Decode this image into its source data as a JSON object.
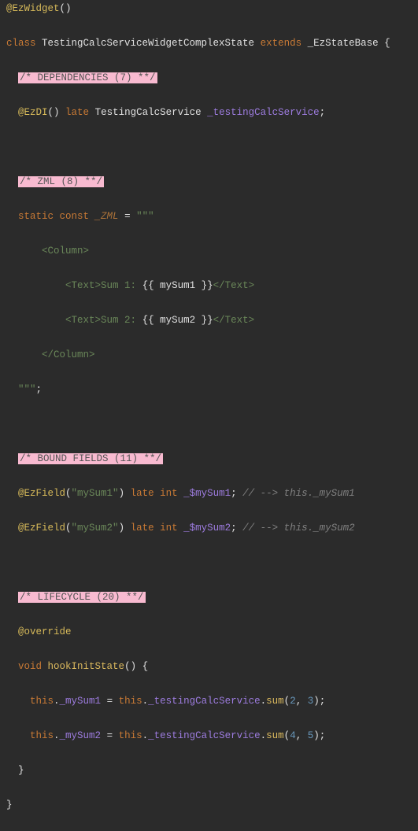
{
  "lines": {
    "l1_ann": "@EzWidget",
    "l1_par": "()",
    "l2_kw1": "class ",
    "l2_cls": "TestingCalcServiceWidgetComplexState",
    "l2_kw2": " extends ",
    "l2_base": "_EzStateBase",
    "l2_end": " {",
    "l3_hl": "/* DEPENDENCIES (7) **/",
    "l4_ann": "@EzDI",
    "l4_par": "()",
    "l4_late": " late ",
    "l4_typ": "TestingCalcService",
    "l4_id": " _testingCalcService",
    "l4_sc": ";",
    "l7_hl": "/* ZML (8) **/",
    "l8_kw": "static const ",
    "l8_id": "_ZML",
    "l8_eq": " = ",
    "l8_q": "\"\"\"",
    "l9": "    <Column>",
    "l10a": "        <Text>",
    "l10b": "Sum 1: ",
    "l10c": "{{ mySum1 }}",
    "l10d": "</Text>",
    "l11a": "        <Text>",
    "l11b": "Sum 2: ",
    "l11c": "{{ mySum2 }}",
    "l11d": "</Text>",
    "l12": "    </Column>",
    "l13_q": "\"\"\"",
    "l13_sc": ";",
    "l16_hl": "/* BOUND FIELDS (11) **/",
    "l17_ann": "@EzField",
    "l17_par1": "(",
    "l17_str": "\"mySum1\"",
    "l17_par2": ")",
    "l17_late": " late ",
    "l17_typ": "int",
    "l17_id": " _$mySum1",
    "l17_sc": ";",
    "l17_cmt": " // --> this._mySum1",
    "l18_ann": "@EzField",
    "l18_par1": "(",
    "l18_str": "\"mySum2\"",
    "l18_par2": ")",
    "l18_late": " late ",
    "l18_typ": "int",
    "l18_id": " _$mySum2",
    "l18_sc": ";",
    "l18_cmt": " // --> this._mySum2",
    "l21_hl": "/* LIFECYCLE (20) **/",
    "l22_ann": "@override",
    "l23_kw": "void ",
    "l23_fn": "hookInitState",
    "l23_par": "() {",
    "l24_a": "    ",
    "l24_this1": "this",
    "l24_b": ".",
    "l24_f1": "_mySum1",
    "l24_eq": " = ",
    "l24_this2": "this",
    "l24_c": ".",
    "l24_svc": "_testingCalcService",
    "l24_d": ".",
    "l24_m": "sum",
    "l24_p1": "(",
    "l24_n1": "2",
    "l24_cm": ", ",
    "l24_n2": "3",
    "l24_p2": ");",
    "l25_a": "    ",
    "l25_this1": "this",
    "l25_b": ".",
    "l25_f1": "_mySum2",
    "l25_eq": " = ",
    "l25_this2": "this",
    "l25_c": ".",
    "l25_svc": "_testingCalcService",
    "l25_d": ".",
    "l25_m": "sum",
    "l25_p1": "(",
    "l25_n1": "4",
    "l25_cm": ", ",
    "l25_n2": "5",
    "l25_p2": ");",
    "l26": "  }",
    "l27": "}"
  }
}
